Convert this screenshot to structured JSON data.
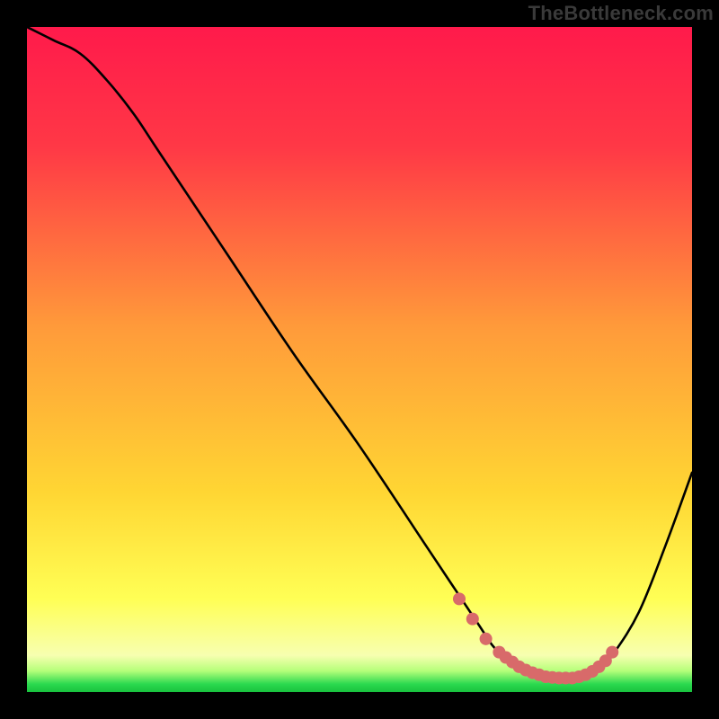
{
  "watermark": "TheBottleneck.com",
  "colors": {
    "top": "#ff1a4b",
    "mid1": "#ff7a3c",
    "mid2": "#ffd633",
    "low": "#ffff66",
    "bottom_green": "#2bd94f",
    "curve": "#000000",
    "dots": "#d86a6a"
  },
  "chart_data": {
    "type": "line",
    "title": "",
    "xlabel": "",
    "ylabel": "",
    "xlim": [
      0,
      100
    ],
    "ylim": [
      0,
      100
    ],
    "series": [
      {
        "name": "bottleneck-curve",
        "x": [
          0,
          4,
          8,
          12,
          16,
          20,
          30,
          40,
          50,
          60,
          64,
          68,
          70,
          72,
          74,
          76,
          78,
          80,
          82,
          84,
          86,
          88,
          92,
          96,
          100
        ],
        "y": [
          100,
          98,
          96,
          92,
          87,
          81,
          66,
          51,
          37,
          22,
          16,
          10,
          7,
          5,
          3.5,
          2.8,
          2.3,
          2.1,
          2.1,
          2.4,
          3.2,
          5.5,
          12,
          22,
          33
        ]
      }
    ],
    "dots": {
      "name": "highlight-dots",
      "x": [
        65,
        67,
        69,
        71,
        72,
        73,
        74,
        75,
        76,
        77,
        78,
        79,
        80,
        81,
        82,
        83,
        84,
        85,
        86,
        87,
        88
      ],
      "y": [
        14,
        11,
        8,
        6,
        5.2,
        4.5,
        3.8,
        3.3,
        2.9,
        2.6,
        2.3,
        2.2,
        2.1,
        2.1,
        2.1,
        2.3,
        2.6,
        3.1,
        3.8,
        4.7,
        6.0
      ]
    },
    "gradient_stops": [
      {
        "offset": 0.0,
        "color": "#ff1a4b"
      },
      {
        "offset": 0.18,
        "color": "#ff3846"
      },
      {
        "offset": 0.45,
        "color": "#ff9a3a"
      },
      {
        "offset": 0.7,
        "color": "#ffd633"
      },
      {
        "offset": 0.86,
        "color": "#ffff55"
      },
      {
        "offset": 0.945,
        "color": "#f7ffb0"
      },
      {
        "offset": 0.968,
        "color": "#b6ff7a"
      },
      {
        "offset": 0.988,
        "color": "#2bd94f"
      },
      {
        "offset": 1.0,
        "color": "#18c23e"
      }
    ]
  }
}
